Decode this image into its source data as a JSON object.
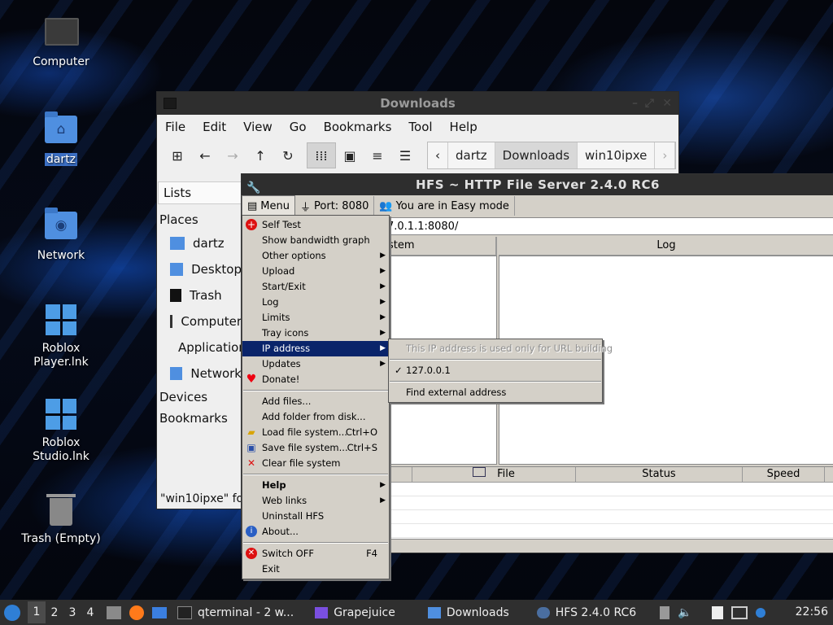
{
  "desktop": {
    "icons": [
      {
        "label": "Computer"
      },
      {
        "label": "dartz"
      },
      {
        "label": "Network"
      },
      {
        "label": "Roblox Player.lnk"
      },
      {
        "label": "Roblox Studio.lnk"
      },
      {
        "label": "Trash (Empty)"
      }
    ]
  },
  "file_manager": {
    "title": "Downloads",
    "menu": [
      "File",
      "Edit",
      "View",
      "Go",
      "Bookmarks",
      "Tool",
      "Help"
    ],
    "breadcrumbs": [
      "dartz",
      "Downloads",
      "win10ipxe"
    ],
    "side_tab": "Lists",
    "places_header": "Places",
    "places": [
      "dartz",
      "Desktop",
      "Trash",
      "Computer",
      "Applications",
      "Network"
    ],
    "devices_header": "Devices",
    "bookmarks_header": "Bookmarks",
    "status": "\"win10ipxe\" fo"
  },
  "hfs": {
    "title": "HFS ~ HTTP File Server 2.4.0 RC6",
    "menu_button": "Menu",
    "port": "Port: 8080",
    "mode": "You are in Easy mode",
    "url": "7.0.1.1:8080/",
    "vfs_header": "stem",
    "log_header": "Log",
    "conn_columns": [
      "File",
      "Status",
      "Speed"
    ]
  },
  "popup_menu": {
    "items": [
      {
        "label": "Self Test",
        "icon": "plus-cross-icon"
      },
      {
        "label": "Show bandwidth graph"
      },
      {
        "label": "Other options",
        "submenu": true
      },
      {
        "label": "Upload",
        "submenu": true
      },
      {
        "label": "Start/Exit",
        "submenu": true
      },
      {
        "label": "Log",
        "submenu": true
      },
      {
        "label": "Limits",
        "submenu": true
      },
      {
        "label": "Tray icons",
        "submenu": true
      },
      {
        "label": "IP address",
        "submenu": true,
        "highlighted": true
      },
      {
        "label": "Updates",
        "submenu": true
      },
      {
        "label": "Donate!",
        "icon": "heart-icon"
      },
      {
        "label": "Add files..."
      },
      {
        "label": "Add folder from disk..."
      },
      {
        "label": "Load file system...",
        "shortcut": "Ctrl+O",
        "icon": "open-folder-icon"
      },
      {
        "label": "Save file system...",
        "shortcut": "Ctrl+S",
        "icon": "floppy-icon"
      },
      {
        "label": "Clear file system",
        "icon": "red-x-icon"
      },
      {
        "label": "Help",
        "submenu": true,
        "bold": true
      },
      {
        "label": "Web links",
        "submenu": true
      },
      {
        "label": "Uninstall HFS"
      },
      {
        "label": "About...",
        "icon": "info-icon"
      },
      {
        "label": "Switch OFF",
        "shortcut": "F4",
        "icon": "power-icon"
      },
      {
        "label": "Exit"
      }
    ]
  },
  "ip_submenu": {
    "info": "This IP address is used only for URL building",
    "checked_ip": "127.0.0.1",
    "find_external": "Find external address"
  },
  "taskbar": {
    "workspaces": [
      "1",
      "2",
      "3",
      "4"
    ],
    "tasks": [
      "qterminal - 2 w...",
      "Grapejuice",
      "Downloads",
      "HFS 2.4.0 RC6"
    ],
    "clock": "22:56"
  },
  "colors": {
    "menu_highlight": "#0a246a",
    "folder_blue": "#4f8fe0",
    "titlebar": "#2e2e2e"
  }
}
